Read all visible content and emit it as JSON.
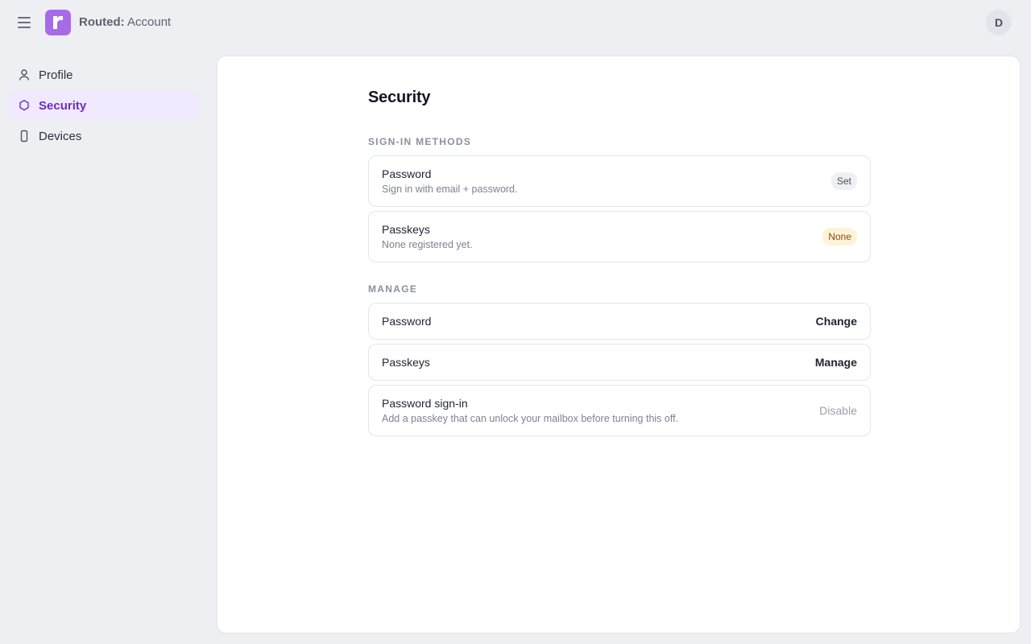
{
  "header": {
    "brand": "Routed:",
    "title": "Account",
    "avatar_initial": "D"
  },
  "sidebar": {
    "items": [
      {
        "label": "Profile",
        "icon": "user-icon",
        "active": false
      },
      {
        "label": "Security",
        "icon": "shield-icon",
        "active": true
      },
      {
        "label": "Devices",
        "icon": "phone-icon",
        "active": false
      }
    ]
  },
  "main": {
    "title": "Security",
    "sign_in_methods": {
      "label": "SIGN-IN METHODS",
      "rows": [
        {
          "title": "Password",
          "desc": "Sign in with email + password.",
          "badge": "Set"
        },
        {
          "title": "Passkeys",
          "desc": "None registered yet.",
          "badge": "None"
        }
      ]
    },
    "manage": {
      "label": "MANAGE",
      "rows": [
        {
          "title": "Password",
          "action": "Change"
        },
        {
          "title": "Passkeys",
          "action": "Manage"
        },
        {
          "title": "Password sign-in",
          "desc": "Add a passkey that can unlock your mailbox before turning this off.",
          "action": "Disable"
        }
      ]
    }
  },
  "colors": {
    "accent": "#6d2dc4",
    "logo": "#a86be8",
    "background": "#eeeff3"
  }
}
